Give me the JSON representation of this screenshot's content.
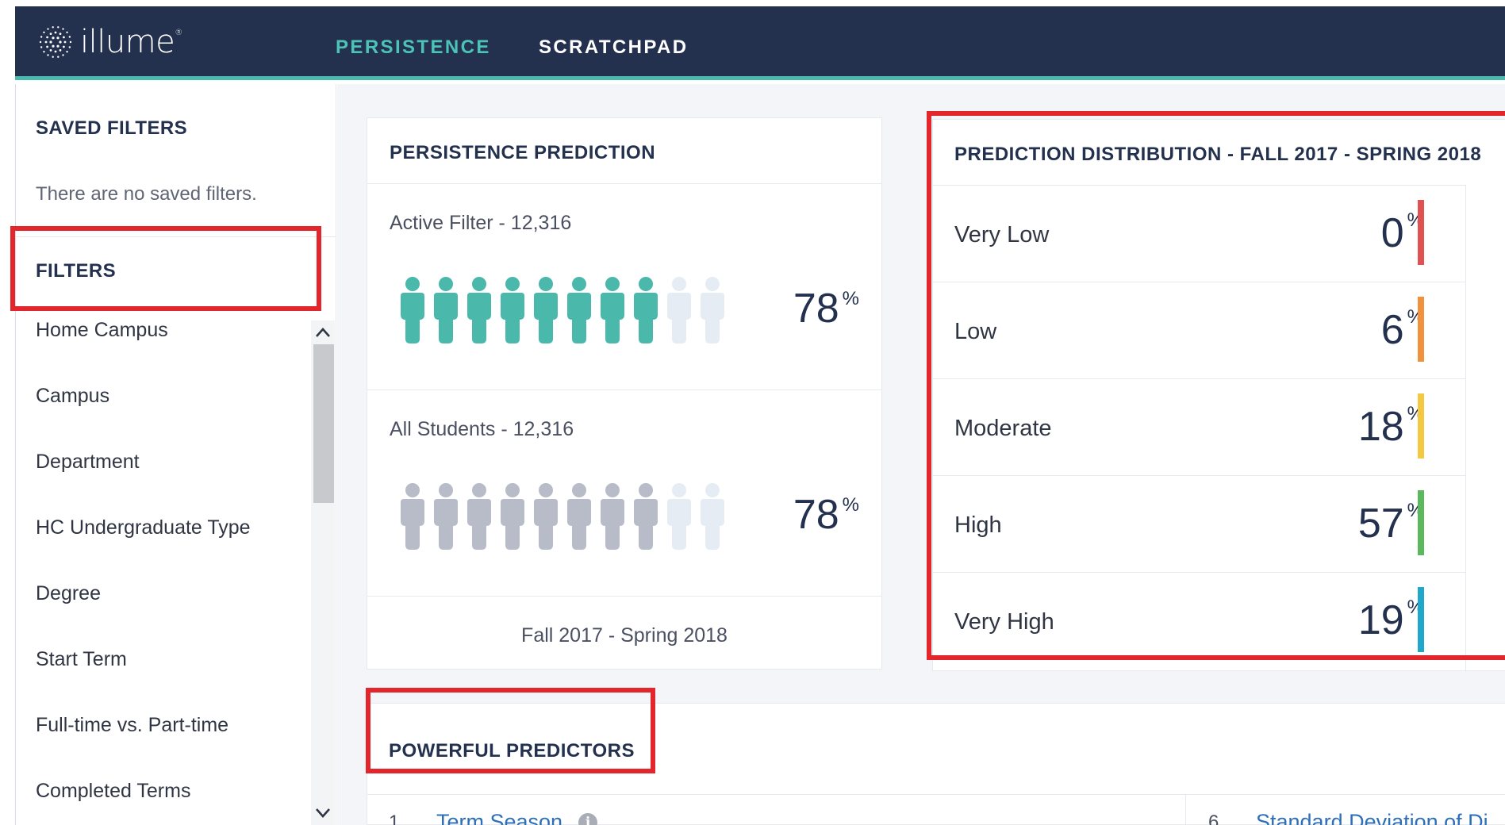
{
  "header": {
    "brand": "illume",
    "brand_mark": "®",
    "nav": [
      {
        "label": "PERSISTENCE",
        "active": true
      },
      {
        "label": "SCRATCHPAD",
        "active": false
      }
    ],
    "colors": {
      "nav_bg": "#23314f",
      "accent": "#4bc4b7"
    }
  },
  "sidebar": {
    "saved_filters_heading": "SAVED FILTERS",
    "saved_filters_empty": "There are no saved filters.",
    "filters_heading": "FILTERS",
    "filters": [
      "Home Campus",
      "Campus",
      "Department",
      "HC Undergraduate Type",
      "Degree",
      "Start Term",
      "Full-time vs. Part-time",
      "Completed Terms"
    ]
  },
  "persistence_prediction": {
    "title": "PERSISTENCE PREDICTION",
    "active_filter": {
      "label": "Active Filter - 12,316",
      "percent": "78",
      "unit": "%",
      "color": "#4bb8ac"
    },
    "all_students": {
      "label": "All Students - 12,316",
      "percent": "78",
      "unit": "%",
      "color": "#b7bcc8"
    },
    "icons_filled": 8,
    "icons_total": 10,
    "footer": "Fall 2017 - Spring 2018"
  },
  "prediction_distribution": {
    "title": "PREDICTION DISTRIBUTION - FALL 2017 - SPRING 2018",
    "rows": [
      {
        "label": "Very Low",
        "value": "0",
        "unit": "%",
        "color": "#e05252"
      },
      {
        "label": "Low",
        "value": "6",
        "unit": "%",
        "color": "#f0913e"
      },
      {
        "label": "Moderate",
        "value": "18",
        "unit": "%",
        "color": "#f5c842"
      },
      {
        "label": "High",
        "value": "57",
        "unit": "%",
        "color": "#5cb85c"
      },
      {
        "label": "Very High",
        "value": "19",
        "unit": "%",
        "color": "#1fa8c9"
      }
    ]
  },
  "powerful_predictors": {
    "title": "POWERFUL PREDICTORS",
    "items": [
      {
        "rank": "1",
        "name": "Term Season"
      },
      {
        "rank": "6",
        "name": "Standard Deviation of Di"
      }
    ]
  }
}
